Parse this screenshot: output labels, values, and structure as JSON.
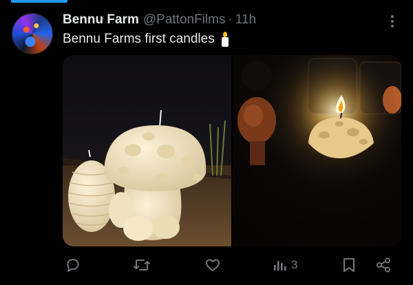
{
  "post": {
    "display_name": "Bennu Farm",
    "handle": "@PattonFilms",
    "separator": "·",
    "time": "11h",
    "text": "Bennu Farms first candles"
  },
  "media": [
    {
      "name": "candles-photo",
      "icon": "mushroom-candle-and-beehive-candle"
    },
    {
      "name": "lit-candle-photo",
      "icon": "lit-mushroom-candle"
    }
  ],
  "actions": {
    "reply_icon": "reply-icon",
    "repost_icon": "repost-icon",
    "like_icon": "like-icon",
    "views_icon": "views-icon",
    "views_count": "3",
    "bookmark_icon": "bookmark-icon",
    "share_icon": "share-icon"
  },
  "colors": {
    "background": "#000000",
    "text": "#e7e9ea",
    "secondary": "#71767b",
    "accent": "#1d9bf0"
  }
}
